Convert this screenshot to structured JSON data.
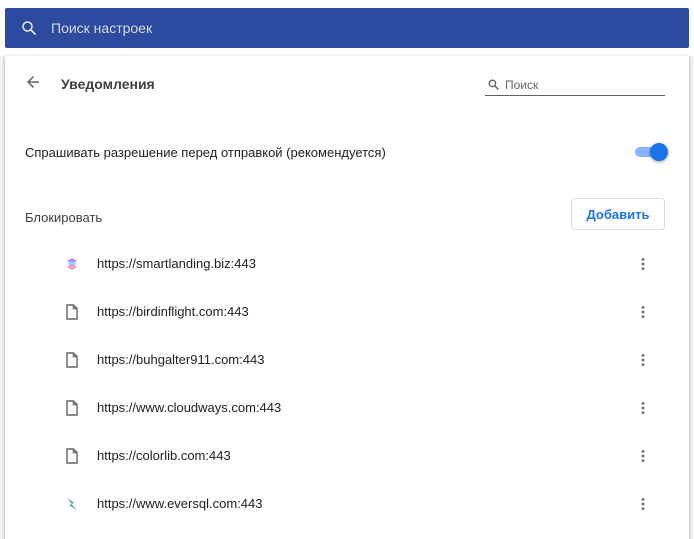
{
  "top_search": {
    "placeholder": "Поиск настроек",
    "icon": "search-icon"
  },
  "header": {
    "back_icon": "arrow-back-icon",
    "title": "Уведомления",
    "search_placeholder": "Поиск"
  },
  "ask_setting": {
    "label": "Спрашивать разрешение перед отправкой (рекомендуется)",
    "enabled": true
  },
  "block_section": {
    "label": "Блокировать",
    "add_label": "Добавить"
  },
  "sites": [
    {
      "url": "https://smartlanding.biz:443",
      "icon": "smartlanding-favicon"
    },
    {
      "url": "https://birdinflight.com:443",
      "icon": "page-icon"
    },
    {
      "url": "https://buhgalter911.com:443",
      "icon": "page-icon"
    },
    {
      "url": "https://www.cloudways.com:443",
      "icon": "page-icon"
    },
    {
      "url": "https://colorlib.com:443",
      "icon": "page-icon"
    },
    {
      "url": "https://www.eversql.com:443",
      "icon": "eversql-favicon"
    }
  ],
  "colors": {
    "search_bar": "#2c4a9e",
    "accent": "#1a73e8",
    "toggle_track": "#8ab4f8"
  }
}
